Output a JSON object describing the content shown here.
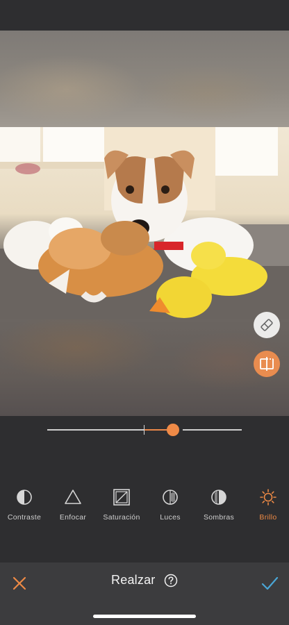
{
  "editor": {
    "title": "Realzar",
    "slider": {
      "value_fraction": 0.64,
      "center_fraction": 0.5
    }
  },
  "tools": [
    {
      "label": "Contraste",
      "icon": "contrast-icon",
      "active": false
    },
    {
      "label": "Enfocar",
      "icon": "triangle-icon",
      "active": false
    },
    {
      "label": "Saturación",
      "icon": "saturation-icon",
      "active": false
    },
    {
      "label": "Luces",
      "icon": "highlights-icon",
      "active": false
    },
    {
      "label": "Sombras",
      "icon": "shadows-icon",
      "active": false
    },
    {
      "label": "Brillo",
      "icon": "sun-icon",
      "active": true
    }
  ],
  "actions": {
    "cancel_icon": "close-icon",
    "confirm_icon": "check-icon",
    "help_icon": "help-icon"
  },
  "floating_buttons": {
    "eraser_icon": "eraser-icon",
    "compare_icon": "compare-icon"
  },
  "colors": {
    "accent": "#ee8a45",
    "background": "#2e2e30",
    "bottom_bar": "#3c3c3e",
    "confirm": "#4aa6d6"
  }
}
